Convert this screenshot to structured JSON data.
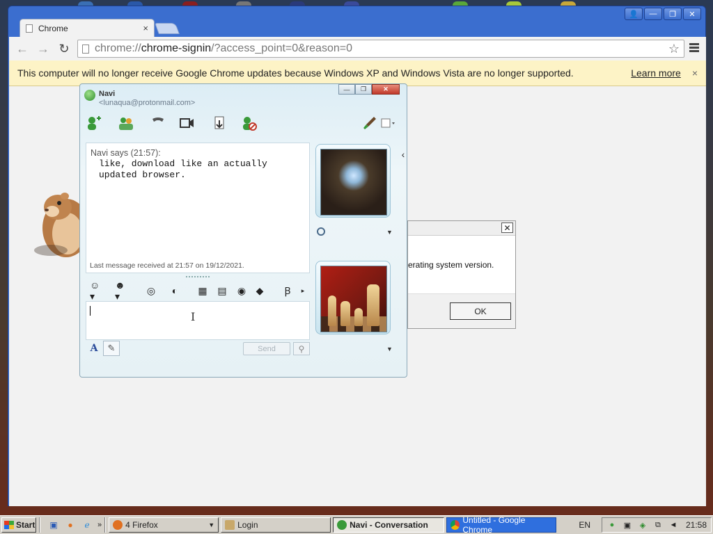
{
  "browser": {
    "tab_title": "Chrome",
    "tab_close": "×",
    "url_scheme": "chrome://",
    "url_host": "chrome-signin",
    "url_rest": "/?access_point=0&reason=0",
    "back": "←",
    "forward": "→",
    "reload": "↻",
    "star": "☆",
    "infobar_message": "This computer will no longer receive Google Chrome updates because Windows XP and Windows Vista are no longer supported.",
    "learn_more": "Learn more",
    "infobar_close": "×",
    "window_controls": [
      "👤",
      "—",
      "❐",
      "✕"
    ]
  },
  "messenger": {
    "contact_name": "Navi",
    "contact_email": "<lunaqua@protonmail.com>",
    "controls": [
      "—",
      "❐",
      "✕"
    ],
    "message_header": "Navi says (21:57):",
    "message_body": "like, download like an actually\nupdated browser.",
    "last_received": "Last message received at 21:57 on 19/12/2021.",
    "font_label": "A",
    "send_label": "Send",
    "collapse": "‹",
    "toolbar_icons": [
      "add-contact-icon",
      "invite-icon",
      "call-icon",
      "video-icon",
      "share-files-icon",
      "block-icon",
      "paint-icon",
      "activities-icon"
    ],
    "format_icons": [
      "emoticon-icon",
      "wink-icon",
      "nudge-icon",
      "voice-clip-icon",
      "background-icon",
      "games-icon",
      "sound-icon",
      "gift-icon",
      "text-format-icon"
    ]
  },
  "dialog": {
    "text": "erating system version.",
    "ok": "OK",
    "close": "✕"
  },
  "taskbar": {
    "start": "Start",
    "tasks": [
      {
        "label": "4 Firefox",
        "icon": "firefox-icon"
      },
      {
        "label": "Login",
        "icon": "login-icon"
      },
      {
        "label": "Navi - Conversation",
        "icon": "messenger-icon"
      },
      {
        "label": "Untitled - Google Chrome",
        "icon": "chrome-icon"
      }
    ],
    "language": "EN",
    "clock": "21:58",
    "more": "»"
  }
}
